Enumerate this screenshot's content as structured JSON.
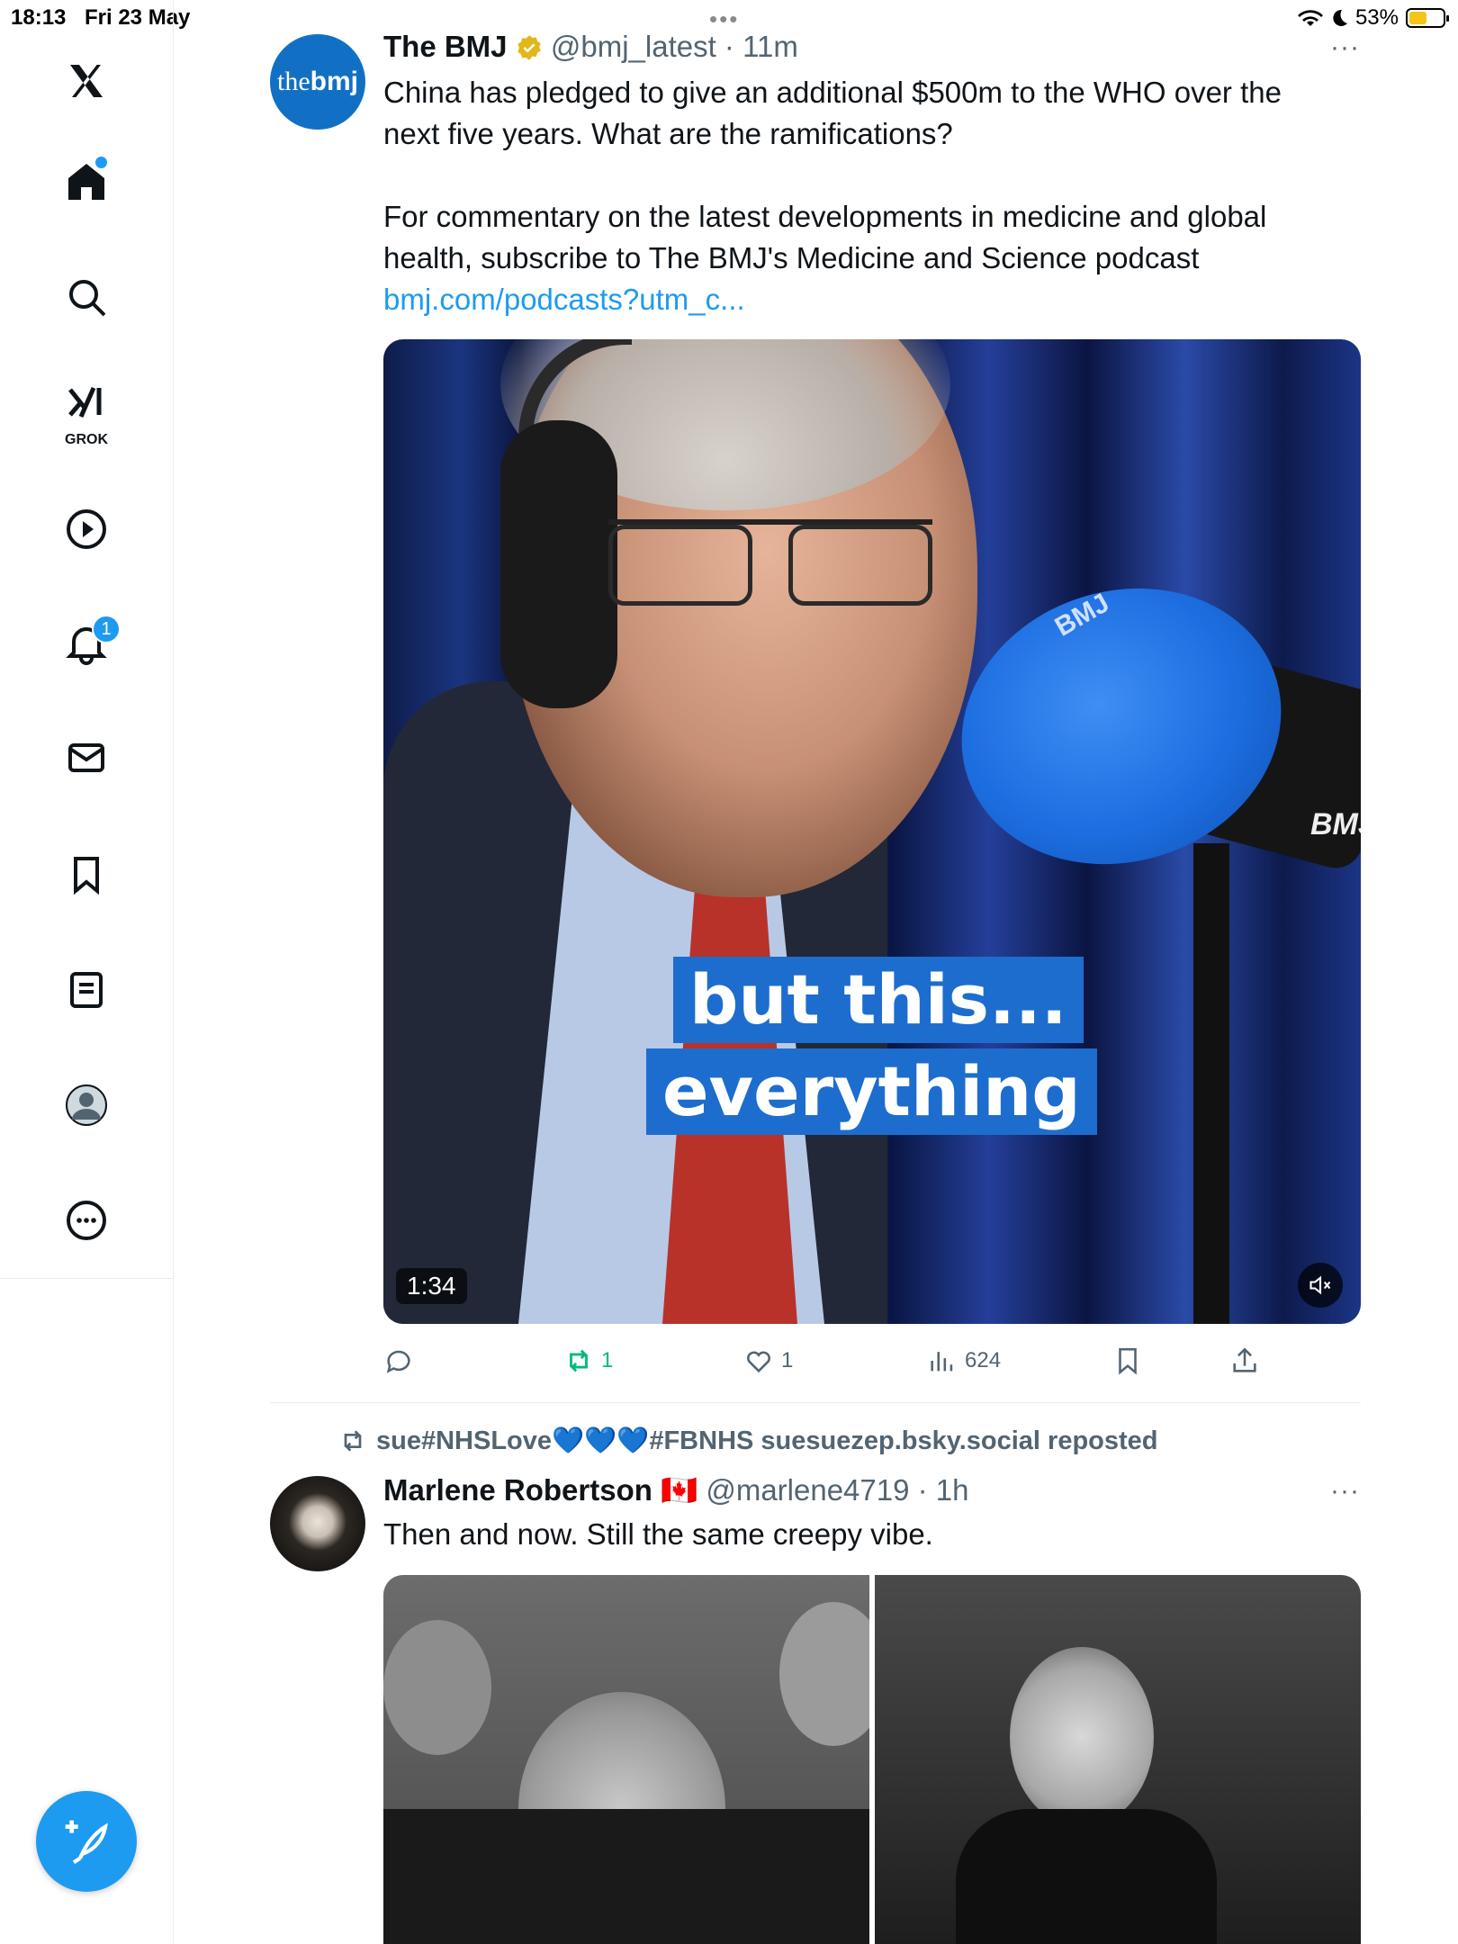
{
  "status_bar": {
    "time": "18:13",
    "date": "Fri 23 May",
    "battery": "53%",
    "battery_level": 0.53
  },
  "sidebar": {
    "items": [
      {
        "name": "x-logo"
      },
      {
        "name": "home",
        "has_dot": true
      },
      {
        "name": "search"
      },
      {
        "name": "grok",
        "label": "GROK"
      },
      {
        "name": "video"
      },
      {
        "name": "notifications",
        "badge": "1"
      },
      {
        "name": "messages"
      },
      {
        "name": "bookmarks"
      },
      {
        "name": "lists"
      },
      {
        "name": "profile"
      },
      {
        "name": "more"
      }
    ],
    "compose_icon": "compose-icon"
  },
  "tweet1": {
    "avatar_text_light": "the",
    "avatar_text_bold": "bmj",
    "name": "The BMJ",
    "handle": "@bmj_latest",
    "time": "11m",
    "text_line1": "China has pledged to give an additional $500m to the WHO over the",
    "text_line2": "next five years. What are the ramifications?",
    "text_line3": "For commentary on the latest developments in medicine and global",
    "text_line4": "health, subscribe to The BMJ's Medicine and Science podcast",
    "link": "bmj.com/podcasts?utm_c...",
    "video": {
      "caption_line1": "but this...",
      "caption_line2": "everything",
      "duration": "1:34",
      "mic_logo": "BMJ",
      "mic_logo_top": "BMJ"
    },
    "stats": {
      "reposts": "1",
      "likes": "1",
      "views": "624"
    }
  },
  "tweet2": {
    "repost_label": "sue#NHSLove💙💙💙#FBNHS suesuezep.bsky.social reposted",
    "name": "Marlene Robertson",
    "flag": "🇨🇦",
    "handle": "@marlene4719",
    "time": "1h",
    "text": "Then and now.  Still the same  creepy vibe."
  },
  "colors": {
    "accent": "#1d9bf0",
    "retweet_green": "#00ba7c",
    "muted": "#536471",
    "bmj_blue": "#1270c4"
  }
}
